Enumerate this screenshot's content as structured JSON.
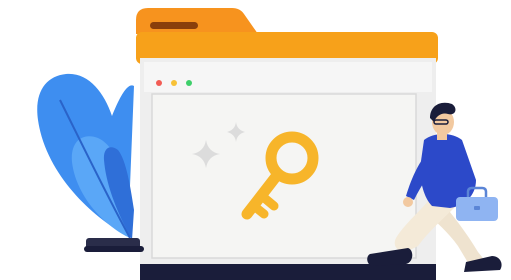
{
  "illustration": {
    "elements": {
      "folder": "folder-icon",
      "browser_window": "browser-window",
      "key": "key-icon",
      "sparkles": "sparkle-icon",
      "plant": "plant-illustration",
      "person": "person-illustration",
      "briefcase": "briefcase-icon"
    },
    "window_controls": [
      {
        "name": "close-dot",
        "color": "#f25c54"
      },
      {
        "name": "minimize-dot",
        "color": "#f7c137"
      },
      {
        "name": "maximize-dot",
        "color": "#3ecf6a"
      }
    ],
    "colors": {
      "folder_tab": "#f7931e",
      "folder_body": "#f7a11a",
      "window_frame": "#e6e6e6",
      "window_panel": "#f4f4f3",
      "key": "#f7b52a",
      "plant_leaf": "#3e8ef0",
      "shirt": "#2c49c9",
      "pants": "#f1e6d3",
      "briefcase": "#8fb4f2",
      "base": "#1a1d3a"
    }
  }
}
